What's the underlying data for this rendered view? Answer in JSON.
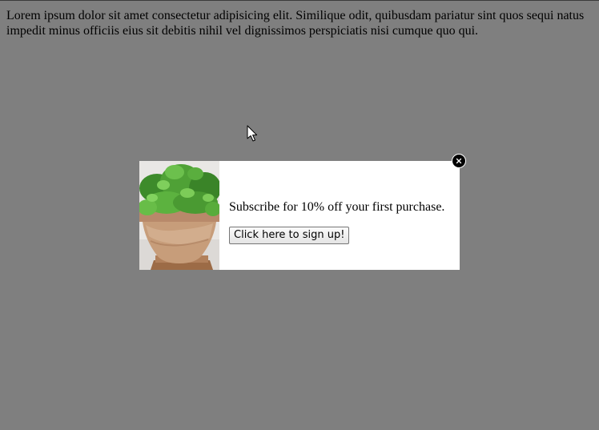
{
  "page": {
    "paragraph": "Lorem ipsum dolor sit amet consectetur adipisicing elit. Similique odit, quibusdam pariatur sint quos sequi natus impedit minus officiis eius sit debitis nihil vel dignissimos perspiciatis nisi cumque quo qui."
  },
  "modal": {
    "message": "Subscribe for 10% off your first purchase.",
    "button_label": "Click here to sign up!",
    "image_icon": "potted-plant-photo",
    "close_icon": "close-icon"
  },
  "colors": {
    "overlay": "#808080",
    "modal_background": "#ffffff",
    "close_button": "#000000"
  }
}
